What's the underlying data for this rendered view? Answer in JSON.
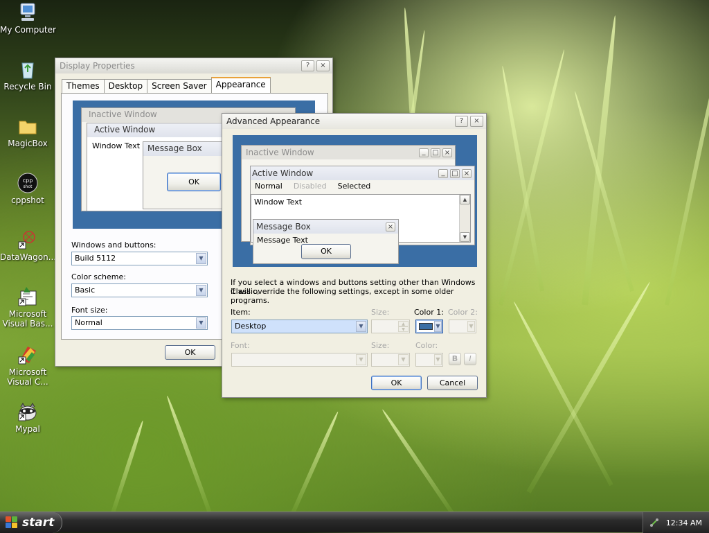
{
  "desktop": {
    "icons": [
      {
        "label": "My Computer",
        "icon": "computer-icon"
      },
      {
        "label": "Recycle Bin",
        "icon": "recycle-bin-icon"
      },
      {
        "label": "MagicBox",
        "icon": "folder-icon"
      },
      {
        "label": "cppshot",
        "icon": "cppshot-icon"
      },
      {
        "label": "DataWagon...",
        "icon": "datawagon-icon"
      },
      {
        "label": "Microsoft Visual Bas...",
        "icon": "visual-basic-icon"
      },
      {
        "label": "Microsoft Visual C...",
        "icon": "visual-c-icon"
      },
      {
        "label": "Mypal",
        "icon": "mypal-icon"
      }
    ]
  },
  "display_properties": {
    "title": "Display Properties",
    "help_btn": "?",
    "close_btn": "×",
    "tabs": [
      "Themes",
      "Desktop",
      "Screen Saver",
      "Appearance"
    ],
    "selected_tab": "Appearance",
    "preview": {
      "inactive_title": "Inactive Window",
      "active_title": "Active Window",
      "window_text": "Window Text",
      "message_box_title": "Message Box",
      "ok": "OK"
    },
    "windows_buttons_label": "Windows and buttons:",
    "windows_buttons_value": "Build 5112",
    "color_scheme_label": "Color scheme:",
    "color_scheme_value": "Basic",
    "font_size_label": "Font size:",
    "font_size_value": "Normal",
    "ok": "OK"
  },
  "advanced_appearance": {
    "title": "Advanced Appearance",
    "help_btn": "?",
    "close_btn": "×",
    "preview": {
      "inactive_title": "Inactive Window",
      "active_title": "Active Window",
      "menu_normal": "Normal",
      "menu_disabled": "Disabled",
      "menu_selected": "Selected",
      "window_text": "Window Text",
      "message_box_title": "Message Box",
      "message_text": "Message Text",
      "ok": "OK"
    },
    "info_line1": "If you select a windows and buttons setting other than Windows Classic,",
    "info_line2": "it will override the following settings, except in some older programs.",
    "item_label": "Item:",
    "item_value": "Desktop",
    "size_label": "Size:",
    "color1_label": "Color 1:",
    "color2_label": "Color 2:",
    "font_label": "Font:",
    "font_size_label": "Size:",
    "font_color_label": "Color:",
    "bold_btn": "B",
    "italic_btn": "I",
    "ok": "OK",
    "cancel": "Cancel",
    "desktop_color": "#3a6ea5"
  },
  "taskbar": {
    "start_label": "start",
    "clock": "12:34 AM"
  }
}
